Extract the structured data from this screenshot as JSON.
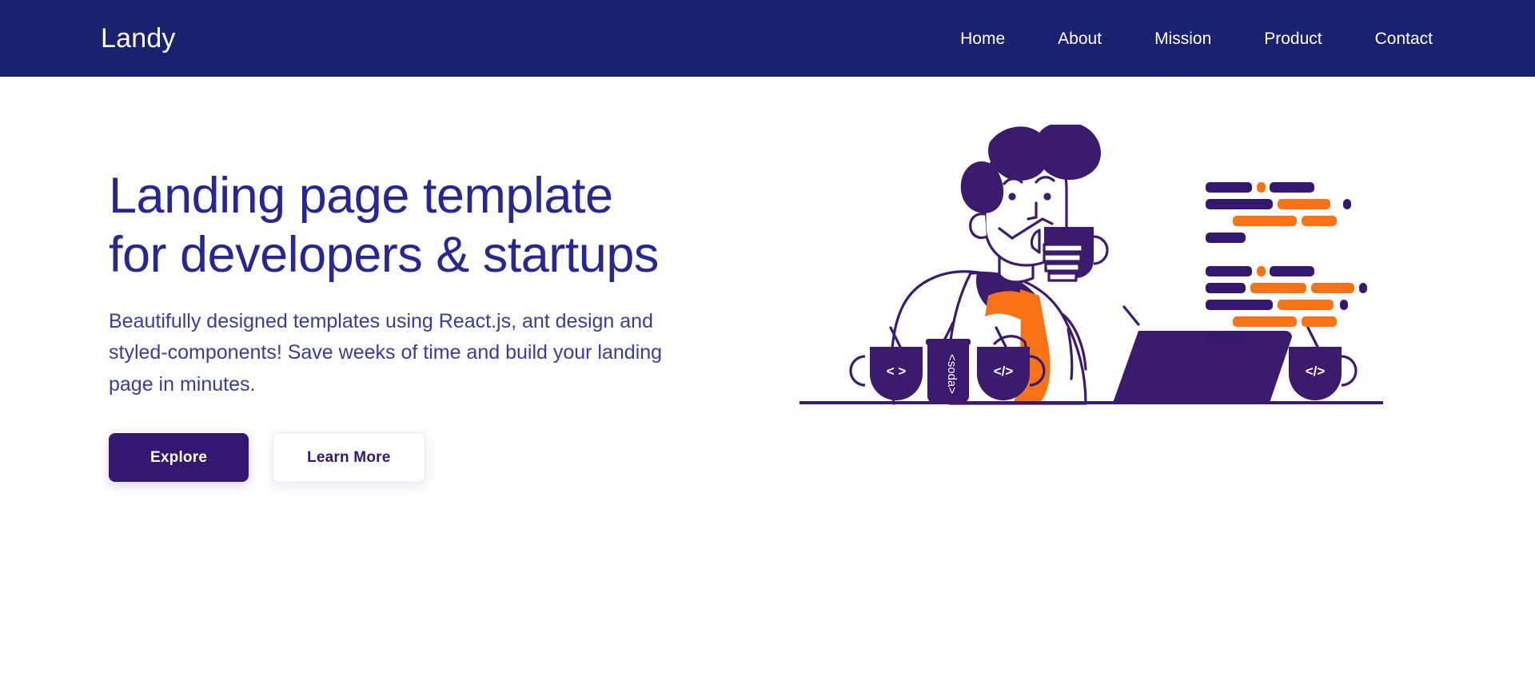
{
  "header": {
    "logo": "Landy",
    "nav": [
      {
        "label": "Home"
      },
      {
        "label": "About"
      },
      {
        "label": "Mission"
      },
      {
        "label": "Product"
      },
      {
        "label": "Contact"
      }
    ]
  },
  "hero": {
    "title": "Landing page template for developers & startups",
    "subtitle": "Beautifully designed templates using React.js, ant design and styled-components! Save weeks of time and build your landing page in minutes.",
    "primary_button": "Explore",
    "secondary_button": "Learn More"
  },
  "illustration": {
    "name": "developer-at-desk-illustration",
    "mug_left_label": "< >",
    "can_label": "<soda>",
    "mug_middle_label": "</>",
    "mug_right_label": "</>"
  },
  "colors": {
    "header_navy": "#1a2270",
    "heading_blue": "#262695",
    "body_blue": "#3b3b9e",
    "deep_purple": "#34176e",
    "illustration_purple": "#3a1b6e",
    "accent_orange": "#f97316",
    "white": "#ffffff"
  }
}
